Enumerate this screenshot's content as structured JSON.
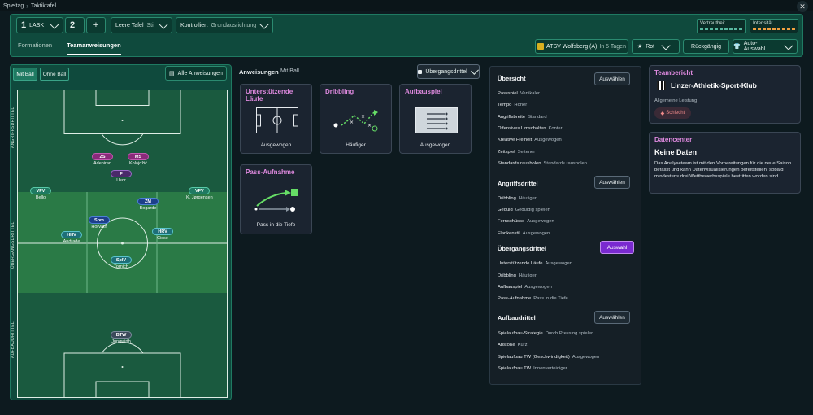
{
  "breadcrumb": [
    "Spieltag",
    "Taktiktafel"
  ],
  "header": {
    "team": {
      "num": "1",
      "label": "LASK"
    },
    "second": {
      "num": "2"
    },
    "add_label": "+",
    "stil": {
      "label": "Leere Tafel",
      "muted": "Stil"
    },
    "grund": {
      "label": "Kontrolliert",
      "muted": "Grundausrichtung"
    },
    "meters": [
      {
        "label": "Vertrautheit"
      },
      {
        "label": "Intensität"
      }
    ]
  },
  "tabs": [
    {
      "label": "Formationen"
    },
    {
      "label": "Teamanweisungen"
    }
  ],
  "toolbar": {
    "opponent": "ATSV Wolfsberg (A)",
    "when": "In 5 Tagen",
    "color_label": "Rot",
    "undo_label": "Rückgängig",
    "auto_label": "Auto-Auswahl"
  },
  "pitch_panel": {
    "mit_ball": "Mit Ball",
    "ohne_ball": "Ohne Ball",
    "alle": "Alle Anweisungen",
    "zones": [
      "ANGRIFFSDRITTEL",
      "ÜBERGANGSDRITTEL",
      "AUFBAUDRITTEL"
    ]
  },
  "players": [
    {
      "role": "ZS",
      "name": "Adeniran"
    },
    {
      "role": "MS",
      "name": "Kolajdžić"
    },
    {
      "role": "F",
      "name": "Usor"
    },
    {
      "role": "VFV",
      "name": "Bello"
    },
    {
      "role": "VFV",
      "name": "K. Jørgensen"
    },
    {
      "role": "ZM",
      "name": "Bogarde"
    },
    {
      "role": "Spm",
      "name": "Horváth"
    },
    {
      "role": "HHV",
      "name": "Andrade"
    },
    {
      "role": "HRV",
      "name": "Cissé"
    },
    {
      "role": "SpIV",
      "name": "Tornich"
    },
    {
      "role": "BTW",
      "name": "Jungwirth"
    }
  ],
  "instructions": {
    "title": "Anweisungen",
    "subtitle": "Mit Ball",
    "zone_select": "Übergangsdrittel",
    "cards": [
      {
        "title": "Unterstützende Läufe",
        "caption": "Ausgewogen"
      },
      {
        "title": "Dribbling",
        "caption": "Häufiger"
      },
      {
        "title": "Aufbauspiel",
        "caption": "Ausgewogen"
      },
      {
        "title": "Pass-Aufnahme",
        "caption": "Pass in die Tiefe"
      }
    ]
  },
  "overview": {
    "sections": [
      {
        "title": "Übersicht",
        "button": "Auswählen",
        "rows": [
          {
            "k": "Passspiel",
            "v": "Vertikaler"
          },
          {
            "k": "Tempo",
            "v": "Höher"
          },
          {
            "k": "Angriffsbreite",
            "v": "Standard"
          },
          {
            "k": "Offensives Umschalten",
            "v": "Konter"
          },
          {
            "k": "Kreative Freiheit",
            "v": "Ausgewogen"
          },
          {
            "k": "Zeitspiel",
            "v": "Seltener"
          },
          {
            "k": "Standards rausholen",
            "v": "Standards rausholen"
          }
        ]
      },
      {
        "title": "Angriffsdrittel",
        "button": "Auswählen",
        "rows": [
          {
            "k": "Dribbling",
            "v": "Häufiger"
          },
          {
            "k": "Geduld",
            "v": "Geduldig spielen"
          },
          {
            "k": "Fernschüsse",
            "v": "Ausgewogen"
          },
          {
            "k": "Flankenstil",
            "v": "Ausgewogen"
          }
        ]
      },
      {
        "title": "Übergangsdrittel",
        "button": "Auswahl",
        "rows": [
          {
            "k": "Unterstützende Läufe",
            "v": "Ausgewogen"
          },
          {
            "k": "Dribbling",
            "v": "Häufiger"
          },
          {
            "k": "Aufbauspiel",
            "v": "Ausgewogen"
          },
          {
            "k": "Pass-Aufnahme",
            "v": "Pass in die Tiefe"
          }
        ]
      },
      {
        "title": "Aufbaudrittel",
        "button": "Auswählen",
        "rows": [
          {
            "k": "Spielaufbau-Strategie",
            "v": "Durch Pressing spielen"
          },
          {
            "k": "Abstöße",
            "v": "Kurz"
          },
          {
            "k": "Spielaufbau TW (Geschwindigkeit)",
            "v": "Ausgewogen"
          },
          {
            "k": "Spielaufbau TW",
            "v": "Innenverteidiger"
          }
        ]
      }
    ]
  },
  "teambericht": {
    "title": "Teambericht",
    "club": "Linzer-Athletik-Sport-Klub",
    "leistung_label": "Allgemeine Leistung",
    "leistung_value": "Schlecht"
  },
  "datencenter": {
    "title": "Datencenter",
    "headline": "Keine Daten",
    "text": "Das Analyseteam ist mit den Vorbereitungen für die neue Saison befasst und kann Datenvisualisierungen bereitstellen, sobald mindestens drei Wettbewerbsspiele bestritten worden sind."
  },
  "colors": {
    "accent_purple": "#7a2ad0",
    "panel_green": "#0f4a3d",
    "card_title": "#e08ae0"
  }
}
